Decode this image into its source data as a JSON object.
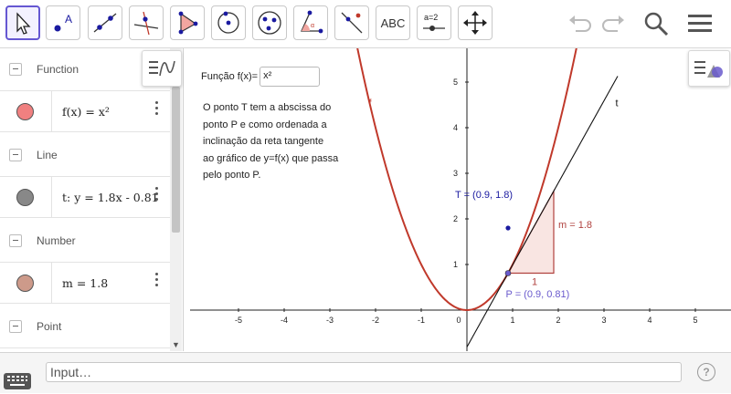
{
  "toolbar": {
    "tools": [
      {
        "name": "move-tool-icon"
      },
      {
        "name": "point-tool-icon",
        "label": "A"
      },
      {
        "name": "line-tool-icon"
      },
      {
        "name": "perpendicular-line-tool-icon"
      },
      {
        "name": "polygon-tool-icon"
      },
      {
        "name": "circle-tool-icon"
      },
      {
        "name": "ellipse-tool-icon"
      },
      {
        "name": "angle-tool-icon",
        "label": "α"
      },
      {
        "name": "reflect-tool-icon"
      },
      {
        "name": "text-tool-icon",
        "label": "ABC"
      },
      {
        "name": "slider-tool-icon",
        "label": "a=2"
      },
      {
        "name": "move-graphics-view-tool-icon"
      }
    ],
    "right": [
      "undo-icon",
      "redo-icon",
      "search-icon",
      "menu-icon"
    ]
  },
  "algebra": {
    "categories": [
      {
        "label": "Function"
      },
      {
        "label": "Line"
      },
      {
        "label": "Number"
      },
      {
        "label": "Point"
      }
    ],
    "items": [
      {
        "expr": "f(x)  =  x²",
        "color": "#f08080"
      },
      {
        "expr": "t: y = 1.8x - 0.81",
        "color": "#888888"
      },
      {
        "expr": "m = 1.8",
        "color": "#cd9a8a"
      }
    ]
  },
  "graphics": {
    "input_label": "Função f(x)=",
    "input_value": "x²",
    "description": [
      "O ponto T tem a abscissa do",
      "ponto P e como ordenada a",
      "inclinação da reta tangente",
      "ao gráfico de y=f(x) que passa",
      "pelo ponto P."
    ],
    "labels": {
      "f": "f",
      "t": "t",
      "T": "T = (0.9, 1.8)",
      "P": "P = (0.9, 0.81)",
      "m": "m = 1.8",
      "one": "1"
    },
    "x_ticks": [
      "-5",
      "-4",
      "-3",
      "-2",
      "-1",
      "0",
      "1",
      "2",
      "3",
      "4",
      "5"
    ],
    "y_ticks": [
      "1",
      "2",
      "3",
      "4",
      "5"
    ],
    "colors": {
      "curve": "#c0392b",
      "slope_triangle": "#b0413e",
      "point_T": "#1a1aa0",
      "point_P": "#6a5acd"
    }
  },
  "input_bar": {
    "placeholder": "Input…",
    "help": "?"
  }
}
